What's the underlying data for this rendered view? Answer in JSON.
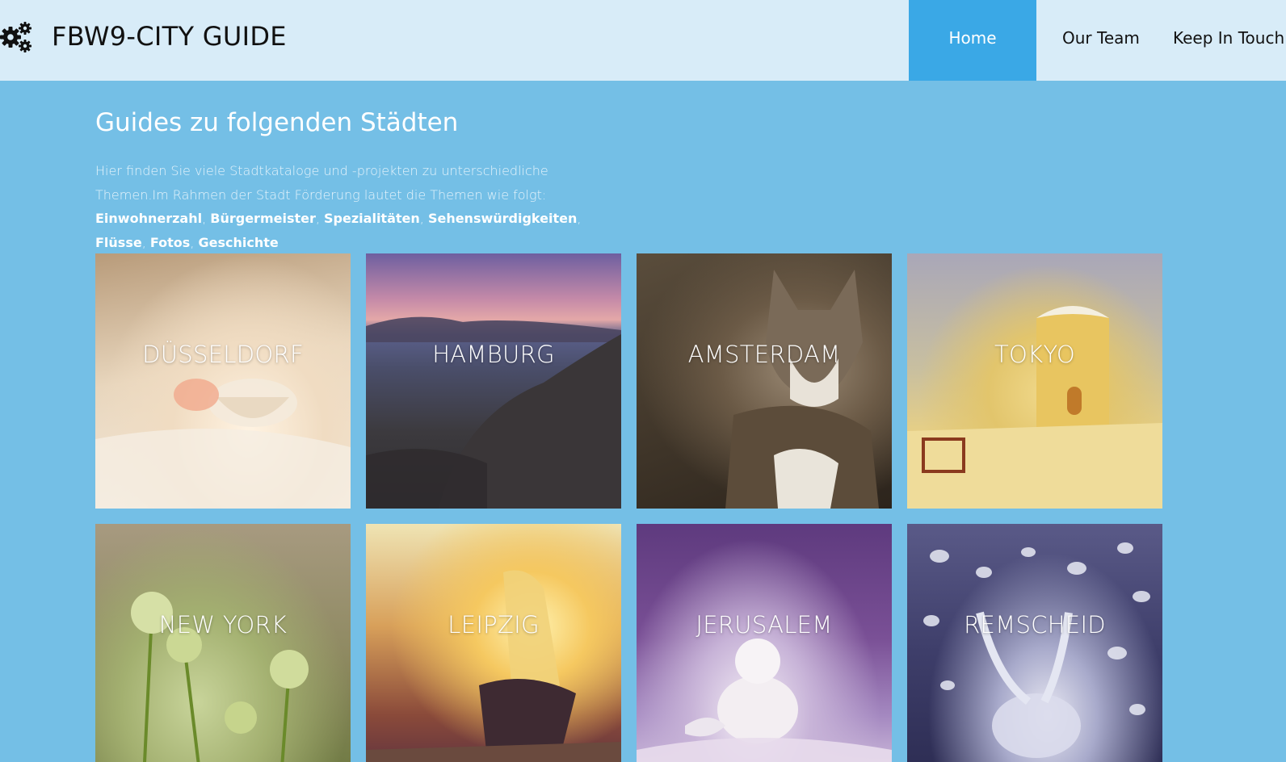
{
  "header": {
    "brand": "FBW9-CITY GUIDE",
    "logo_icon": "gears-icon",
    "nav": [
      {
        "label": "Home",
        "active": true
      },
      {
        "label": "Our Team",
        "active": false
      },
      {
        "label": "Keep In Touch",
        "active": false
      }
    ]
  },
  "intro": {
    "title": "Guides zu folgenden Städten",
    "text_prefix": "Hier finden Sie viele Stadtkataloge und -projekten zu unterschiedliche Themen.Im Rahmen der Stadt Förderung lautet die Themen wie folgt: ",
    "topics": [
      "Einwohnerzahl",
      "Bürgermeister",
      "Spezialitäten",
      "Sehenswürdigkeiten",
      "Flüsse",
      "Fotos",
      "Geschichte"
    ],
    "separator": ", "
  },
  "cities": [
    {
      "name": "DÜSSELDORF"
    },
    {
      "name": "HAMBURG"
    },
    {
      "name": "AMSTERDAM"
    },
    {
      "name": "TOKYO"
    },
    {
      "name": "NEW YORK"
    },
    {
      "name": "LEIPZIG"
    },
    {
      "name": "JERUSALEM"
    },
    {
      "name": "REMSCHEID"
    }
  ],
  "colors": {
    "page_background": "#74bfe6",
    "header_background": "#d8ecf8",
    "nav_active_background": "#3aa8e6"
  }
}
